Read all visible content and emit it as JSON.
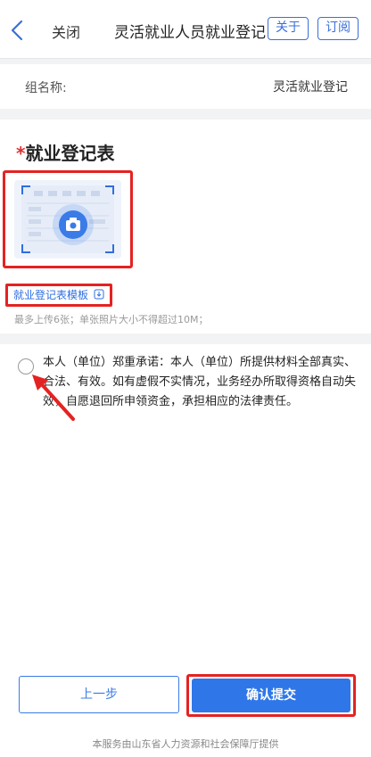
{
  "nav": {
    "close_label": "关闭",
    "title": "灵活就业人员就业登记",
    "about_label": "关于",
    "subscribe_label": "订阅"
  },
  "group": {
    "label": "组名称:",
    "value": "灵活就业登记"
  },
  "form": {
    "required_mark": "*",
    "section_title": "就业登记表",
    "template_link": "就业登记表模板",
    "upload_hint": "最多上传6张；单张照片大小不得超过10M；"
  },
  "promise": {
    "text": "本人（单位）郑重承诺：本人（单位）所提供材料全部真实、合法、有效。如有虚假不实情况，业务经办所取得资格自动失效，自愿退回所申领资金，承担相应的法律责任。"
  },
  "actions": {
    "prev_label": "上一步",
    "confirm_label": "确认提交"
  },
  "footer": {
    "text": "本服务由山东省人力资源和社会保障厅提供"
  },
  "colors": {
    "primary": "#2f77e8",
    "highlight": "#e52222"
  }
}
